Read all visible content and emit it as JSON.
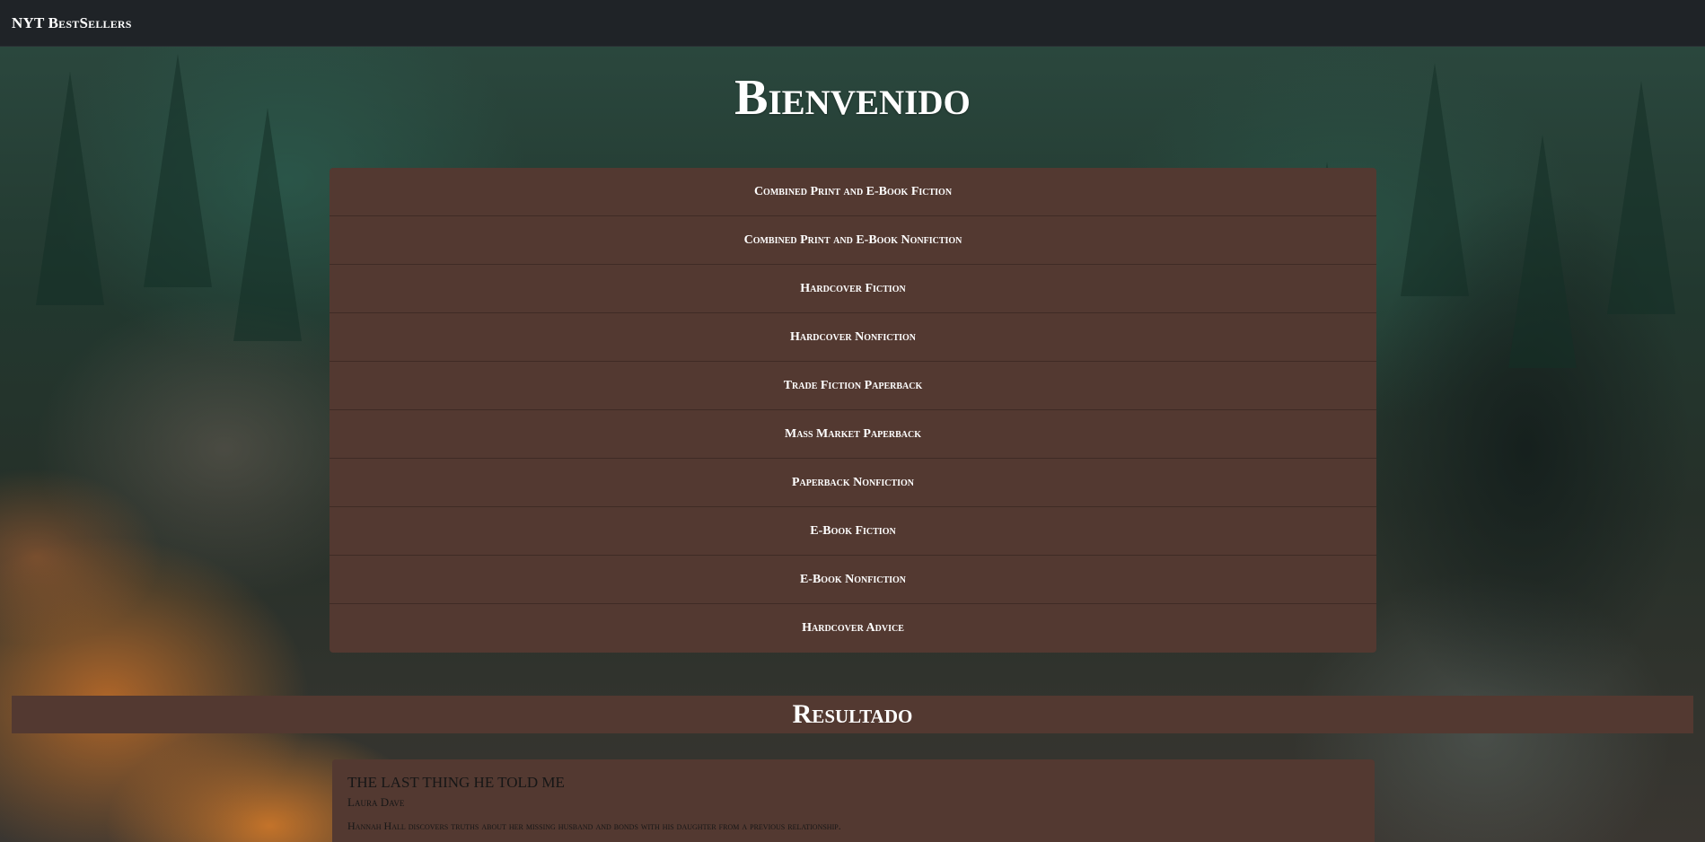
{
  "navbar": {
    "brand": "NYT BestSellers"
  },
  "welcome": {
    "title": "Bienvenido"
  },
  "categories": [
    "Combined Print and E-Book Fiction",
    "Combined Print and E-Book Nonfiction",
    "Hardcover Fiction",
    "Hardcover Nonfiction",
    "Trade Fiction Paperback",
    "Mass Market Paperback",
    "Paperback Nonfiction",
    "E-Book Fiction",
    "E-Book Nonfiction",
    "Hardcover Advice"
  ],
  "results": {
    "heading": "Resultado",
    "books": [
      {
        "title": "THE LAST THING HE TOLD ME",
        "author": "Laura Dave",
        "description": "Hannah Hall discovers truths about her missing husband and bonds with his daughter from a previous relationship."
      }
    ]
  },
  "colors": {
    "navbar": "#1f2327",
    "panel": "#533931",
    "panel_border": "#3f2b25",
    "text_light": "#ffffff",
    "text_dark": "#161616"
  }
}
